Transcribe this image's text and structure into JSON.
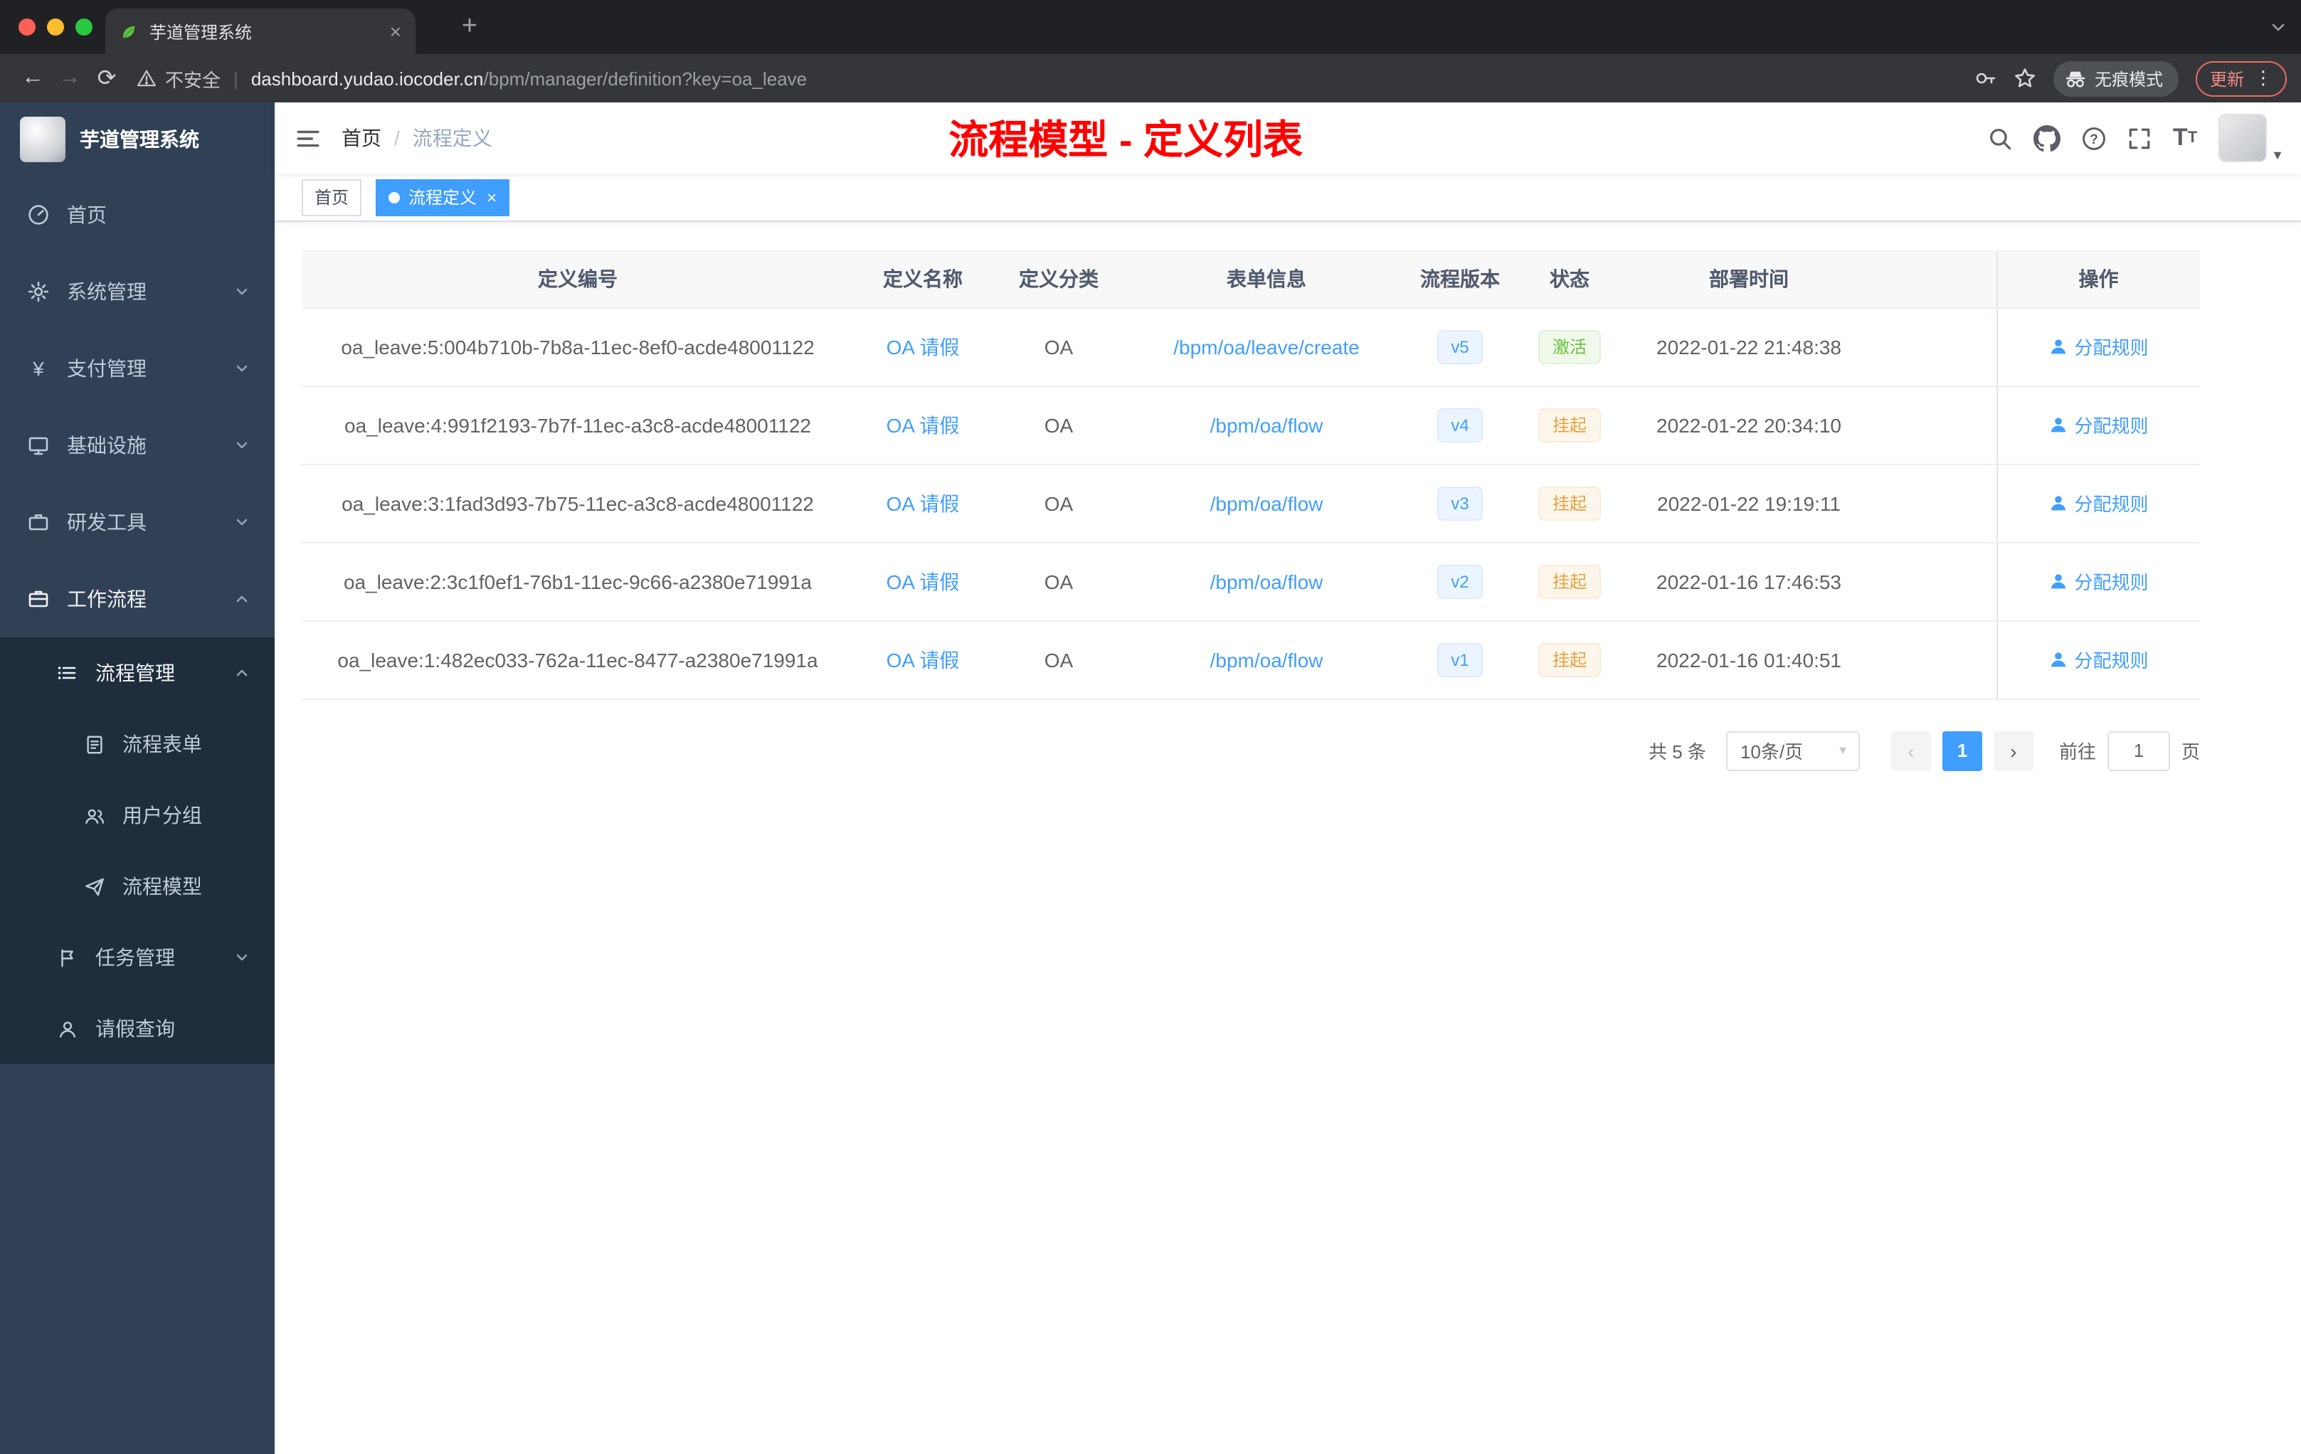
{
  "browser": {
    "tab_title": "芋道管理系统",
    "security_label": "不安全",
    "url_host": "dashboard.yudao.iocoder.cn",
    "url_path": "/bpm/manager/definition?key=oa_leave",
    "incognito_label": "无痕模式",
    "update_label": "更新"
  },
  "sidebar": {
    "logo_title": "芋道管理系统",
    "menu": [
      {
        "label": "首页"
      },
      {
        "label": "系统管理"
      },
      {
        "label": "支付管理"
      },
      {
        "label": "基础设施"
      },
      {
        "label": "研发工具"
      },
      {
        "label": "工作流程"
      }
    ],
    "submenu": {
      "process_management": "流程管理",
      "process_form": "流程表单",
      "user_group": "用户分组",
      "process_model": "流程模型",
      "task_management": "任务管理",
      "leave_query": "请假查询"
    }
  },
  "header": {
    "breadcrumb_home": "首页",
    "breadcrumb_sep": "/",
    "breadcrumb_current": "流程定义",
    "banner": "流程模型 - 定义列表"
  },
  "tags": {
    "home": "首页",
    "active": "流程定义"
  },
  "table": {
    "columns": [
      "定义编号",
      "定义名称",
      "定义分类",
      "表单信息",
      "流程版本",
      "状态",
      "部署时间",
      "操作"
    ],
    "rows": [
      {
        "id": "oa_leave:5:004b710b-7b8a-11ec-8ef0-acde48001122",
        "name": "OA 请假",
        "category": "OA",
        "form": "/bpm/oa/leave/create",
        "version": "v5",
        "status": "激活",
        "time": "2022-01-22 21:48:38",
        "action": "分配规则"
      },
      {
        "id": "oa_leave:4:991f2193-7b7f-11ec-a3c8-acde48001122",
        "name": "OA 请假",
        "category": "OA",
        "form": "/bpm/oa/flow",
        "version": "v4",
        "status": "挂起",
        "time": "2022-01-22 20:34:10",
        "action": "分配规则"
      },
      {
        "id": "oa_leave:3:1fad3d93-7b75-11ec-a3c8-acde48001122",
        "name": "OA 请假",
        "category": "OA",
        "form": "/bpm/oa/flow",
        "version": "v3",
        "status": "挂起",
        "time": "2022-01-22 19:19:11",
        "action": "分配规则"
      },
      {
        "id": "oa_leave:2:3c1f0ef1-76b1-11ec-9c66-a2380e71991a",
        "name": "OA 请假",
        "category": "OA",
        "form": "/bpm/oa/flow",
        "version": "v2",
        "status": "挂起",
        "time": "2022-01-16 17:46:53",
        "action": "分配规则"
      },
      {
        "id": "oa_leave:1:482ec033-762a-11ec-8477-a2380e71991a",
        "name": "OA 请假",
        "category": "OA",
        "form": "/bpm/oa/flow",
        "version": "v1",
        "status": "挂起",
        "time": "2022-01-16 01:40:51",
        "action": "分配规则"
      }
    ]
  },
  "pagination": {
    "total": "共 5 条",
    "page_size": "10条/页",
    "prev": "‹",
    "next": "›",
    "current_page": "1",
    "goto_label": "前往",
    "goto_value": "1",
    "goto_unit": "页"
  },
  "colors": {
    "accent": "#409eff",
    "success": "#67c23a",
    "warning": "#e6a23c",
    "banner_red": "#ff0000",
    "sidebar_bg": "#304156",
    "submenu_bg": "#1f2d3d"
  }
}
